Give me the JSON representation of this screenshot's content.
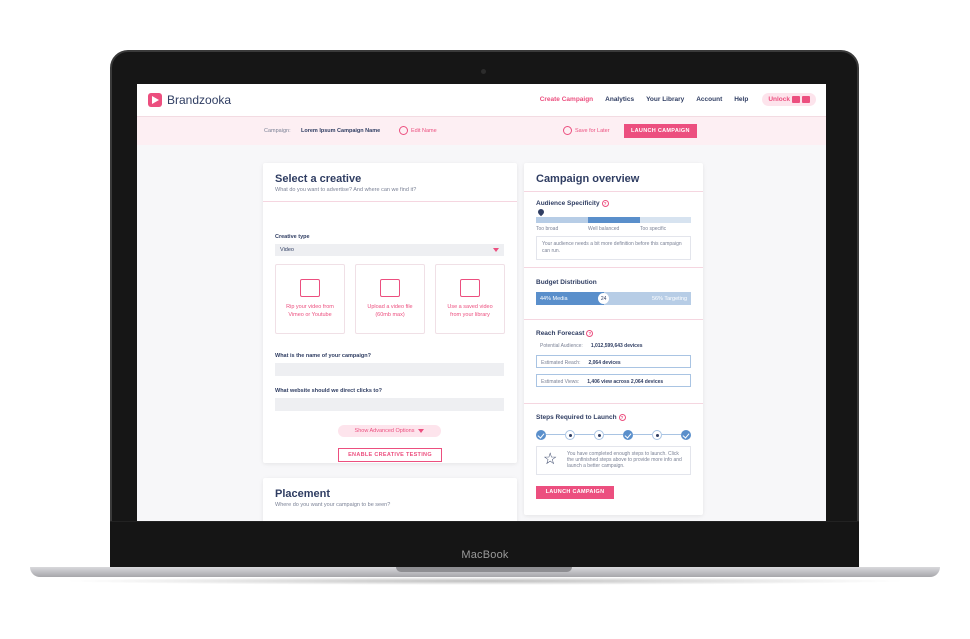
{
  "app": {
    "name": "Brandzooka"
  },
  "nav": {
    "items": [
      "Create Campaign",
      "Analytics",
      "Your Library",
      "Account",
      "Help"
    ],
    "unlock": "Unlock"
  },
  "subbar": {
    "campaign_label": "Campaign:",
    "campaign_name": "Lorem Ipsum Campaign Name",
    "edit_label": "Edit Name",
    "save_label": "Save for Later",
    "launch_label": "LAUNCH CAMPAIGN"
  },
  "creative": {
    "title": "Select a creative",
    "subtitle": "What do you want to advertise? And where can we find it?",
    "type_label": "Creative type",
    "type_value": "Video",
    "options": [
      {
        "line1": "Rip your video from",
        "line2": "Vimeo or Youtube",
        "icon": "link-video-icon"
      },
      {
        "line1": "Upload a video file",
        "line2": "(60mb max)",
        "icon": "upload-folder-icon"
      },
      {
        "line1": "Use a saved video",
        "line2": "from your library",
        "icon": "cloud-video-icon"
      }
    ],
    "name_q": "What is the name of your campaign?",
    "website_q": "What website should we direct clicks to?",
    "advanced": "Show Advanced Options",
    "enable_testing": "ENABLE CREATIVE TESTING"
  },
  "placement": {
    "title": "Placement",
    "subtitle": "Where do you want your campaign to be seen?"
  },
  "overview": {
    "title": "Campaign overview",
    "specificity": {
      "title": "Audience Specificity",
      "labels": [
        "Too broad",
        "Well balanced",
        "Too specific"
      ],
      "note": "Your audience needs a bit more definition before this campaign can run."
    },
    "budget": {
      "title": "Budget Distribution",
      "left": "44% Media",
      "right": "56% Targeting",
      "knob": "24",
      "media_percent": 44
    },
    "reach": {
      "title": "Reach Forecast",
      "potential_label": "Potential Audience:",
      "potential_value": "1,012,599,643 devices",
      "reach_label": "Estimated Reach:",
      "reach_value": "2,064 devices",
      "views_label": "Estimated Views:",
      "views_value": "1,406 view across 2,064 devices"
    },
    "steps": {
      "title": "Steps Required to Launch",
      "states": [
        "done",
        "todo",
        "todo",
        "done",
        "todo",
        "done"
      ],
      "message": "You have completed enough steps to launch. Click the unfinished steps above to provide more info and launch a better campaign."
    },
    "launch_label": "LAUNCH CAMPAIGN"
  },
  "device": {
    "label": "MacBook"
  },
  "colors": {
    "accent": "#ec4f7f",
    "navy": "#2f3d62",
    "blue": "#5a8fcb"
  }
}
